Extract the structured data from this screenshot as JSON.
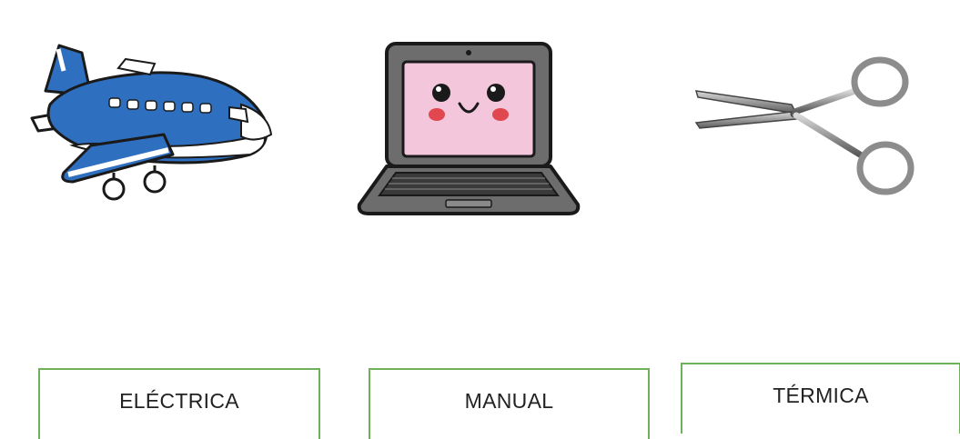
{
  "pictures": {
    "airplane": {
      "icon": "airplane-icon",
      "color": "#2f6fbf"
    },
    "laptop": {
      "icon": "laptop-icon",
      "screen_color": "#f4c6dc"
    },
    "scissors": {
      "icon": "scissors-icon",
      "color": "#8c8c8c"
    }
  },
  "labels": {
    "electrica": "ELÉCTRICA",
    "manual": "MANUAL",
    "termica": "TÉRMICA"
  },
  "colors": {
    "box_border": "#6fb05a",
    "text": "#222222",
    "background": "#ffffff"
  }
}
